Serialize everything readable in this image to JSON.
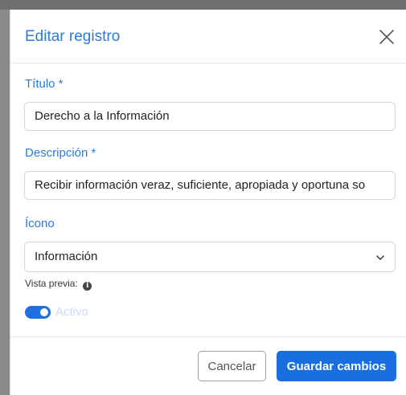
{
  "modal": {
    "title": "Editar registro"
  },
  "form": {
    "title_field": {
      "label": "Título *",
      "value": "Derecho a la Información"
    },
    "description_field": {
      "label": "Descripción *",
      "value": "Recibir información veraz, suficiente, apropiada y oportuna so"
    },
    "icon_field": {
      "label": "Ícono",
      "selected": "Información"
    },
    "preview": {
      "label": "Vista previa:",
      "icon": "info-circle-icon"
    },
    "active_toggle": {
      "label": "Activo",
      "checked": true
    }
  },
  "footer": {
    "cancel_label": "Cancelar",
    "save_label": "Guardar cambios"
  },
  "colors": {
    "accent": "#2a7bd8",
    "primary_button": "#1a6fe0",
    "toggle_on": "#1f6fe0"
  }
}
